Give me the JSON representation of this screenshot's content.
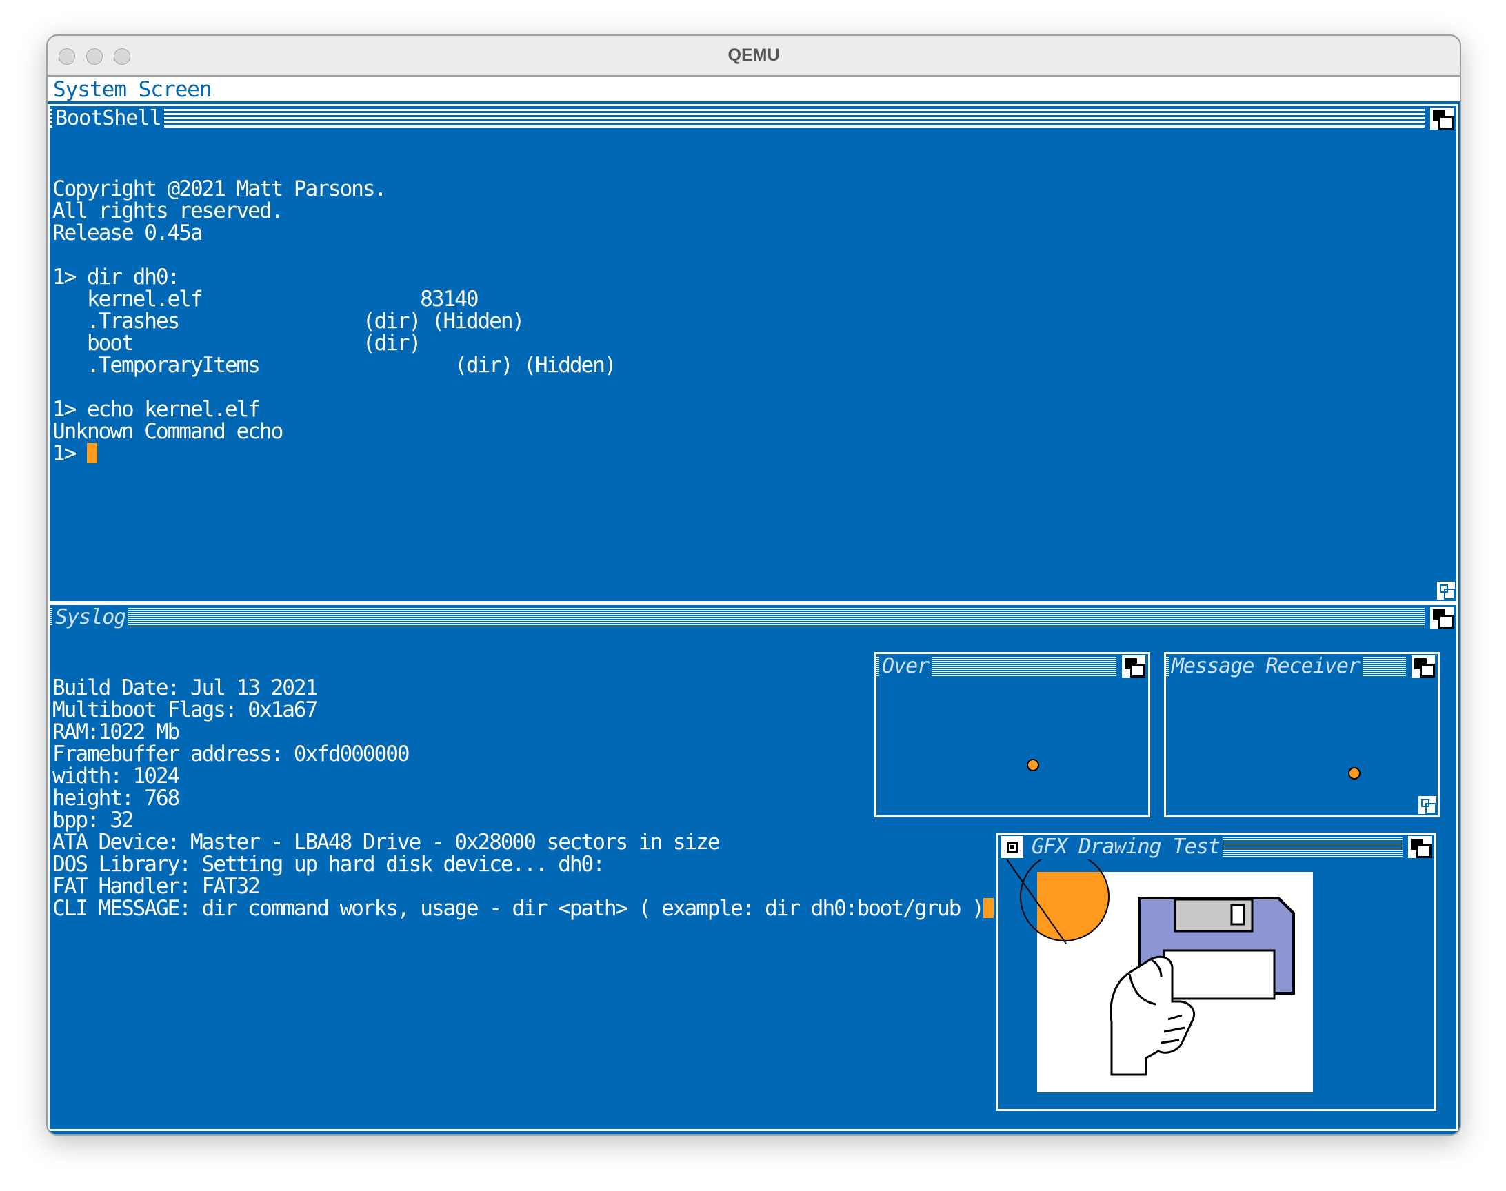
{
  "window": {
    "title": "QEMU"
  },
  "screen": {
    "title": "System Screen"
  },
  "bootshell": {
    "title": "BootShell",
    "lines": [
      "Copyright @2021 Matt Parsons.",
      "All rights reserved.",
      "Release 0.45a",
      "",
      "1> dir dh0:",
      "   kernel.elf                   83140",
      "   .Trashes                (dir) (Hidden)",
      "   boot                    (dir)",
      "   .TemporaryItems                 (dir) (Hidden)",
      "",
      "1> echo kernel.elf",
      "Unknown Command echo"
    ],
    "prompt": "1> "
  },
  "syslog": {
    "title": "Syslog",
    "lines": [
      "Build Date: Jul 13 2021",
      "Multiboot Flags: 0x1a67",
      "RAM:1022 Mb",
      "Framebuffer address: 0xfd000000",
      "width: 1024",
      "height: 768",
      "bpp: 32",
      "ATA Device: Master - LBA48 Drive - 0x28000 sectors in size",
      "DOS Library: Setting up hard disk device... dh0:",
      "FAT Handler: FAT32"
    ],
    "last_line": "CLI MESSAGE: dir command works, usage - dir <path> ( example: dir dh0:boot/grub )"
  },
  "over": {
    "title": "Over"
  },
  "receiver": {
    "title": "Message Receiver"
  },
  "gfx": {
    "title": "GFX Drawing Test"
  },
  "colors": {
    "background": "#0068b4",
    "accent": "#ff9a1f",
    "floppy": "#8c96d2"
  }
}
